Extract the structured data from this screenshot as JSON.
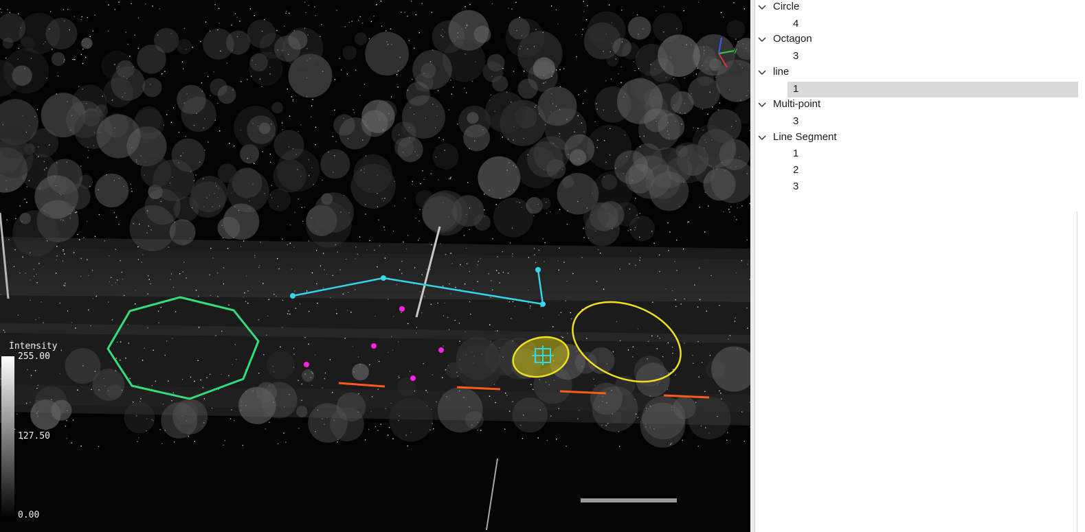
{
  "viewer": {
    "legend": {
      "title": "Intensity",
      "max_label": "255.00",
      "mid_label": "127.50",
      "min_label": "0.00"
    },
    "axes": {
      "y_label": "y"
    },
    "annotation_colors": {
      "octagon": "#31e07a",
      "polyline": "#35d6e8",
      "circle": "#f0e020",
      "points": "#ff21e6",
      "segments": "#ff5a1c"
    }
  },
  "tree": {
    "groups": [
      {
        "label": "Circle",
        "items": [
          "4"
        ]
      },
      {
        "label": "Octagon",
        "items": [
          "3"
        ]
      },
      {
        "label": "line",
        "items": [
          "1"
        ]
      },
      {
        "label": "Multi-point",
        "items": [
          "3"
        ]
      },
      {
        "label": "Line Segment",
        "items": [
          "1",
          "2",
          "3"
        ]
      }
    ],
    "selected": {
      "group": 2,
      "item": 0
    }
  }
}
